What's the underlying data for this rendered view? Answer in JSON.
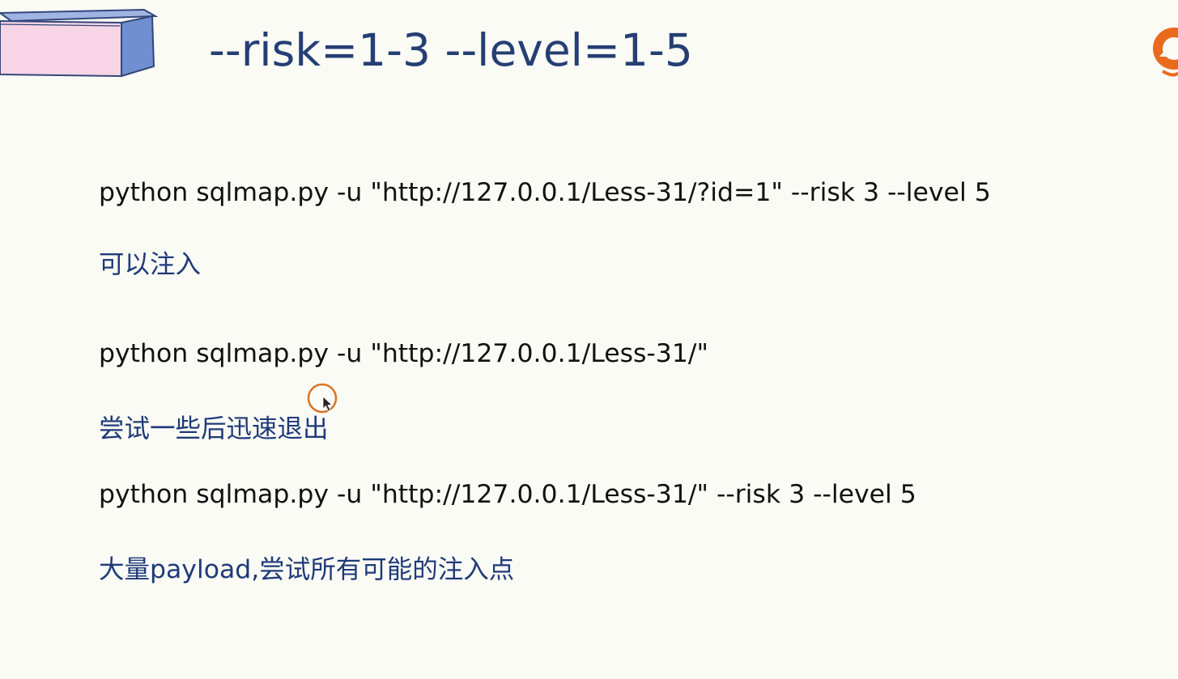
{
  "slide": {
    "title": "--risk=1-3 --level=1-5",
    "lines": [
      {
        "text": "python sqlmap.py -u \"http://127.0.0.1/Less-31/?id=1\"  --risk 3 --level 5",
        "kind": "command"
      },
      {
        "text": "可以注入",
        "kind": "note"
      },
      {
        "text": "python sqlmap.py -u \"http://127.0.0.1/Less-31/\"",
        "kind": "command"
      },
      {
        "text": "尝试一些后迅速退出",
        "kind": "note"
      },
      {
        "text": "python sqlmap.py -u \"http://127.0.0.1/Less-31/\"  --risk 3 --level 5",
        "kind": "command"
      },
      {
        "text": "大量payload,尝试所有可能的注入点",
        "kind": "note"
      }
    ]
  },
  "icons": {
    "logo": "logo-icon",
    "decoration": "header-box-icon",
    "cursor": "mouse-cursor-icon"
  },
  "colors": {
    "background": "#fbfbf6",
    "title": "#253f74",
    "command_text": "#111111",
    "note_text": "#1f3a78",
    "logo_orange": "#ea6a1d",
    "box_pink": "#f7d5e6",
    "box_blue": "#6f8fd0",
    "cursor_ring": "#d9731f"
  }
}
